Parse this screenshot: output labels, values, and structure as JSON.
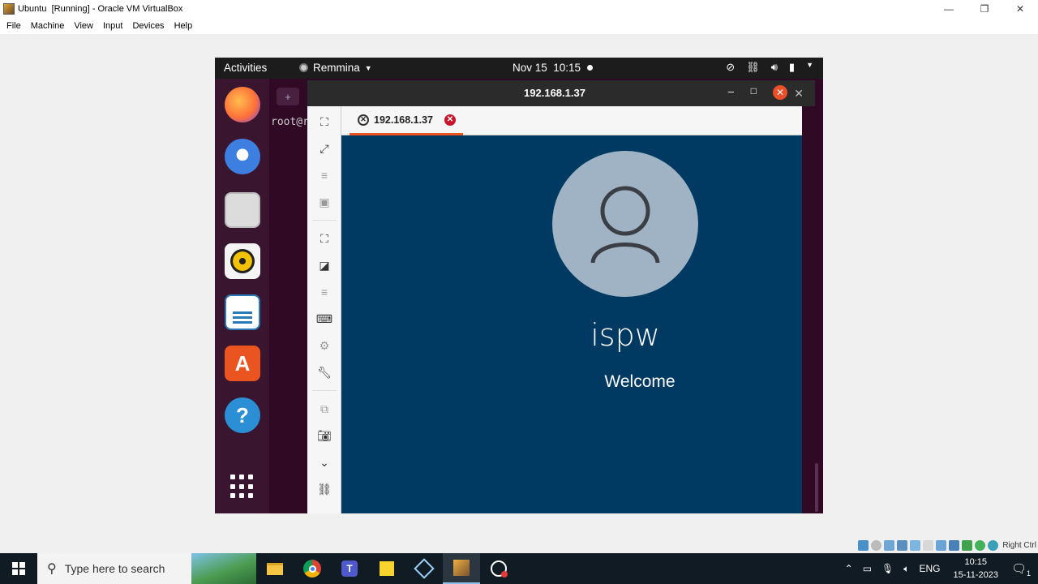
{
  "vbox": {
    "title": "Ubuntu  [Running] - Oracle VM VirtualBox",
    "window_buttons": {
      "minimize": "—",
      "restore": "❐",
      "close": "✕"
    },
    "menu": [
      "File",
      "Machine",
      "View",
      "Input",
      "Devices",
      "Help"
    ],
    "host_key": "Right Ctrl"
  },
  "ubuntu": {
    "activities": "Activities",
    "app_menu": "Remmina",
    "datetime": "Nov 15  10:15",
    "terminal_prompt": "root@r",
    "dock_apps": [
      "firefox",
      "thunderbird",
      "files",
      "rhythmbox",
      "libreoffice-writer",
      "app-center",
      "help"
    ]
  },
  "remmina": {
    "title": "192.168.1.37",
    "tab_label": "192.168.1.37"
  },
  "remote": {
    "username": "ispw",
    "status": "Welcome"
  },
  "taskbar": {
    "search_placeholder": "Type here to search",
    "language": "ENG",
    "time": "10:15",
    "date": "15-11-2023",
    "notification_count": "1"
  },
  "colors": {
    "ubuntu_orange": "#e95420",
    "remote_bg": "#003a63",
    "terminal_bg": "#300a24",
    "taskbar_bg": "#101b24"
  }
}
